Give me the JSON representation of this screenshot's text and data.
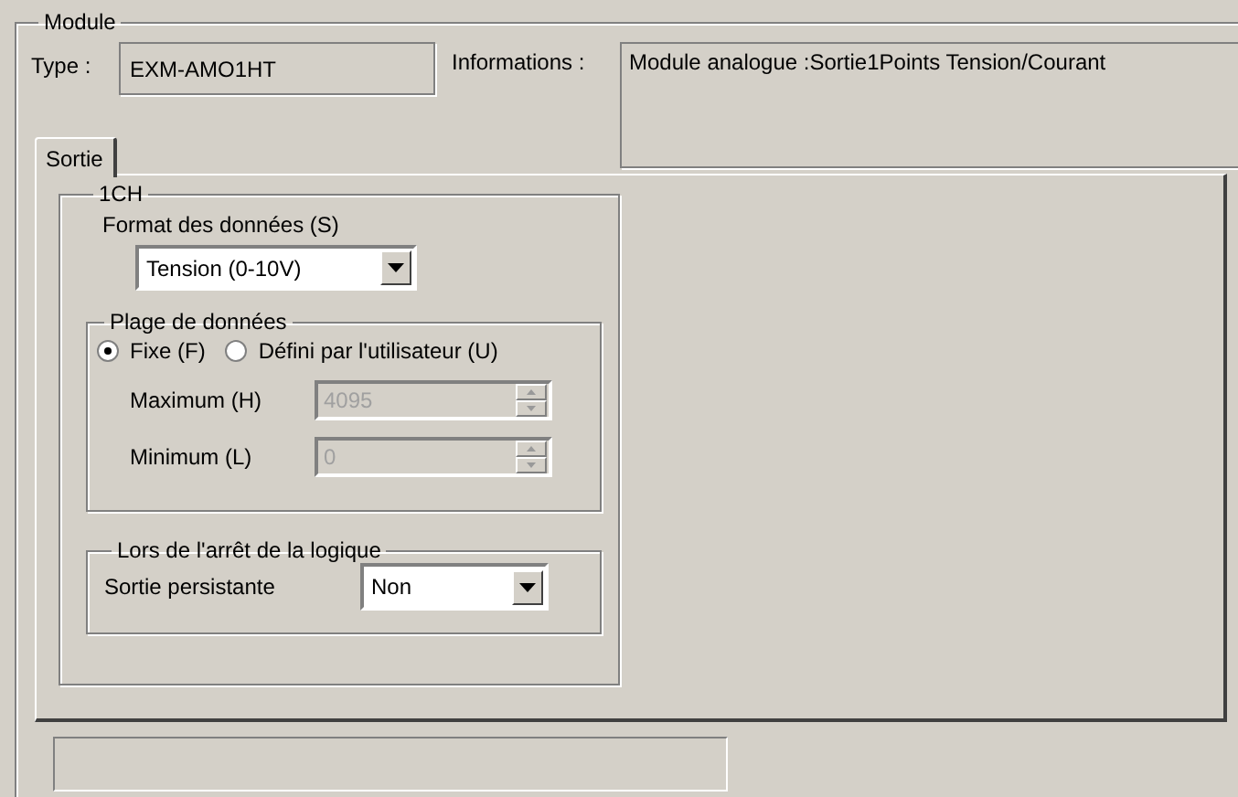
{
  "module": {
    "title": "Module",
    "type_label": "Type :",
    "type_value": "EXM-AMO1HT",
    "info_label": "Informations :",
    "info_value": "Module analogue :Sortie1Points Tension/Courant"
  },
  "tabs": [
    {
      "label": "Sortie",
      "selected": true
    }
  ],
  "channel": {
    "title": "1CH",
    "format_label": "Format des données (S)",
    "format_value": "Tension (0-10V)",
    "range": {
      "title": "Plage de données",
      "options": [
        {
          "label": "Fixe (F)",
          "selected": true
        },
        {
          "label": "Défini par l'utilisateur (U)",
          "selected": false
        }
      ],
      "fields": [
        {
          "label": "Maximum (H)",
          "value": "4095",
          "disabled": true
        },
        {
          "label": "Minimum (L)",
          "value": "0",
          "disabled": true
        }
      ]
    },
    "stop": {
      "title": "Lors de l'arrêt de la logique",
      "label": "Sortie persistante",
      "value": "Non"
    }
  }
}
